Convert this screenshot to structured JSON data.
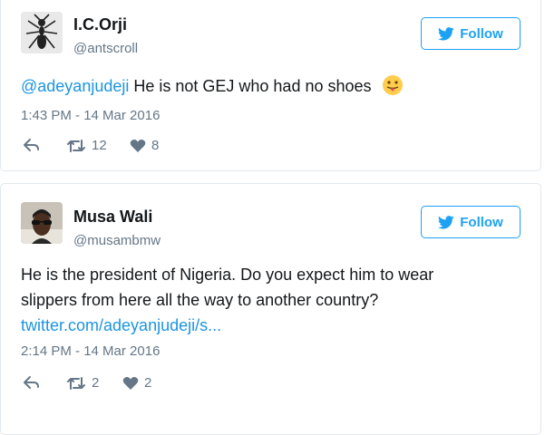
{
  "colors": {
    "accent": "#1da1f2",
    "link": "#1b95e0",
    "muted": "#657786"
  },
  "tweets": [
    {
      "name": "I.C.Orji",
      "handle": "@antscroll",
      "follow_label": "Follow",
      "mention": "@adeyanjudeji",
      "text": " He is not GEJ who had no shoes",
      "emoji": "stuck-out-tongue-emoji",
      "timestamp": "1:43 PM - 14 Mar 2016",
      "retweets": "12",
      "likes": "8"
    },
    {
      "name": "Musa Wali",
      "handle": "@musambmw",
      "follow_label": "Follow",
      "text_line1": "He is the president of Nigeria. Do you expect him to wear",
      "text_line2": "slippers from here all the way to another country?",
      "link": "twitter.com/adeyanjudeji/s...",
      "timestamp": "2:14 PM - 14 Mar 2016",
      "retweets": "2",
      "likes": "2"
    }
  ]
}
